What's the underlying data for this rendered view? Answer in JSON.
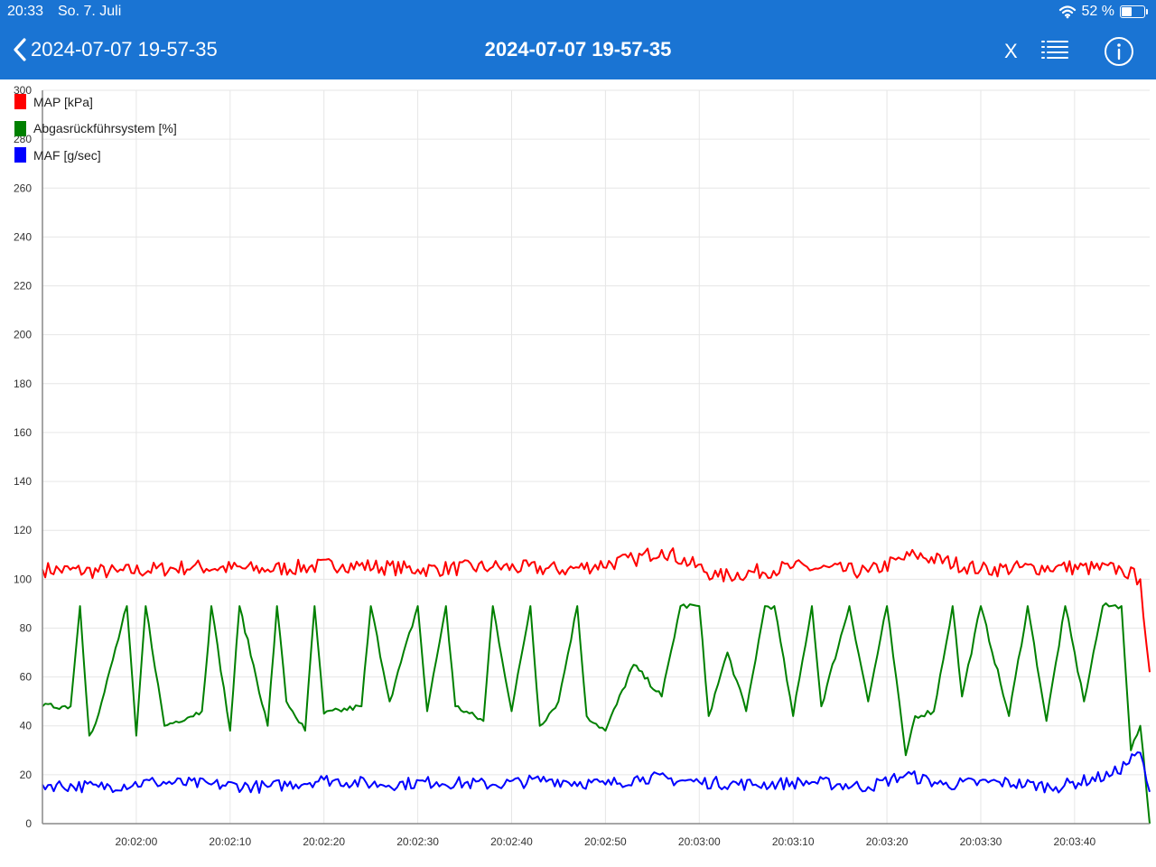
{
  "status_bar": {
    "time": "20:33",
    "date": "So. 7. Juli",
    "battery": "52 %",
    "battery_level": 0.52
  },
  "nav": {
    "back_label": "2024-07-07 19-57-35",
    "title": "2024-07-07 19-57-35",
    "x_label": "X"
  },
  "colors": {
    "header": "#1a74d3",
    "map": "#ff0000",
    "egr": "#008000",
    "maf": "#0000ff"
  },
  "chart_data": {
    "type": "line",
    "title": "",
    "xlabel": "",
    "ylabel": "",
    "ylim": [
      0,
      300
    ],
    "yticks": [
      0,
      20,
      40,
      60,
      80,
      100,
      120,
      140,
      160,
      180,
      200,
      220,
      240,
      260,
      280,
      300
    ],
    "xlim": [
      "20:01:50",
      "20:03:48"
    ],
    "xticks": [
      "20:02:00",
      "20:02:10",
      "20:02:20",
      "20:02:30",
      "20:02:40",
      "20:02:50",
      "20:03:00",
      "20:03:10",
      "20:03:20",
      "20:03:30",
      "20:03:40"
    ],
    "grid": true,
    "legend_position": "top-left",
    "series": [
      {
        "name": "MAP [kPa]",
        "color": "#ff0000",
        "x": [
          "20:01:50",
          "20:01:58",
          "20:02:06",
          "20:02:14",
          "20:02:22",
          "20:02:30",
          "20:02:38",
          "20:02:46",
          "20:02:53",
          "20:02:56",
          "20:03:02",
          "20:03:10",
          "20:03:18",
          "20:03:23",
          "20:03:30",
          "20:03:38",
          "20:03:45",
          "20:03:47",
          "20:03:48"
        ],
        "values": [
          104,
          103,
          105,
          104,
          106,
          104,
          105,
          104,
          108,
          112,
          101,
          105,
          103,
          110,
          104,
          105,
          104,
          100,
          62
        ]
      },
      {
        "name": "Abgasrückführsystem [%]",
        "color": "#008000",
        "x": [
          "20:01:50",
          "20:01:53",
          "20:01:54",
          "20:01:55",
          "20:01:56",
          "20:01:59",
          "20:02:00",
          "20:02:01",
          "20:02:03",
          "20:02:07",
          "20:02:08",
          "20:02:10",
          "20:02:11",
          "20:02:14",
          "20:02:15",
          "20:02:16",
          "20:02:18",
          "20:02:19",
          "20:02:20",
          "20:02:24",
          "20:02:25",
          "20:02:27",
          "20:02:30",
          "20:02:31",
          "20:02:33",
          "20:02:34",
          "20:02:37",
          "20:02:38",
          "20:02:40",
          "20:02:42",
          "20:02:43",
          "20:02:45",
          "20:02:47",
          "20:02:48",
          "20:02:50",
          "20:02:53",
          "20:02:56",
          "20:02:58",
          "20:03:00",
          "20:03:01",
          "20:03:03",
          "20:03:05",
          "20:03:07",
          "20:03:08",
          "20:03:10",
          "20:03:12",
          "20:03:13",
          "20:03:16",
          "20:03:18",
          "20:03:20",
          "20:03:22",
          "20:03:23",
          "20:03:25",
          "20:03:27",
          "20:03:28",
          "20:03:30",
          "20:03:33",
          "20:03:35",
          "20:03:37",
          "20:03:39",
          "20:03:41",
          "20:03:43",
          "20:03:45",
          "20:03:46",
          "20:03:47",
          "20:03:48"
        ],
        "values": [
          48,
          48,
          89,
          36,
          45,
          89,
          36,
          89,
          40,
          46,
          89,
          38,
          89,
          40,
          89,
          50,
          38,
          89,
          45,
          48,
          89,
          50,
          89,
          46,
          89,
          48,
          42,
          89,
          46,
          89,
          40,
          50,
          89,
          44,
          38,
          65,
          52,
          89,
          89,
          44,
          70,
          46,
          89,
          89,
          44,
          89,
          48,
          89,
          50,
          89,
          28,
          44,
          46,
          89,
          52,
          89,
          44,
          89,
          42,
          89,
          50,
          89,
          89,
          30,
          40,
          0
        ]
      },
      {
        "name": "MAF [g/sec]",
        "color": "#0000ff",
        "x": [
          "20:01:50",
          "20:01:56",
          "20:02:02",
          "20:02:08",
          "20:02:14",
          "20:02:20",
          "20:02:26",
          "20:02:32",
          "20:02:38",
          "20:02:44",
          "20:02:50",
          "20:02:54",
          "20:03:00",
          "20:03:06",
          "20:03:12",
          "20:03:18",
          "20:03:22",
          "20:03:26",
          "20:03:32",
          "20:03:38",
          "20:03:44",
          "20:03:47",
          "20:03:48"
        ],
        "values": [
          16,
          15,
          17,
          16,
          15,
          18,
          16,
          17,
          16,
          18,
          16,
          19,
          17,
          16,
          17,
          15,
          20,
          16,
          17,
          15,
          20,
          29,
          13
        ]
      }
    ]
  }
}
